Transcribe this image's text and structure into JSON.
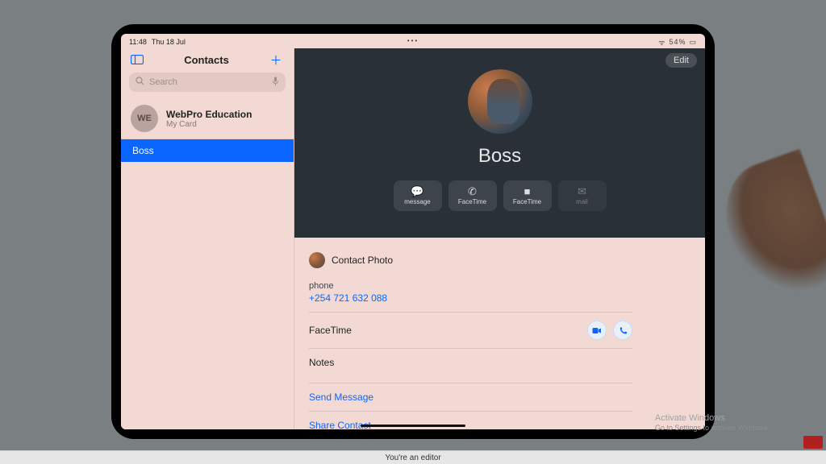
{
  "statusbar": {
    "time": "11:48",
    "date": "Thu 18 Jul",
    "battery_pct": "54%"
  },
  "sidebar": {
    "title": "Contacts",
    "search_placeholder": "Search",
    "mycard": {
      "initials": "WE",
      "name": "WebPro Education",
      "subtitle": "My Card"
    },
    "selected_contact": "Boss"
  },
  "detail": {
    "edit_label": "Edit",
    "contact_name": "Boss",
    "actions": {
      "message": "message",
      "facetime_audio": "FaceTime",
      "facetime_video": "FaceTime",
      "mail": "mail"
    },
    "contact_photo_label": "Contact Photo",
    "phone_label": "phone",
    "phone_value": "+254 721 632 088",
    "facetime_label": "FaceTime",
    "notes_label": "Notes",
    "send_message": "Send Message",
    "share_contact": "Share Contact"
  },
  "watermark": {
    "title": "Activate Windows",
    "subtitle": "Go to Settings to activate Windows."
  },
  "footer": "You're an editor"
}
